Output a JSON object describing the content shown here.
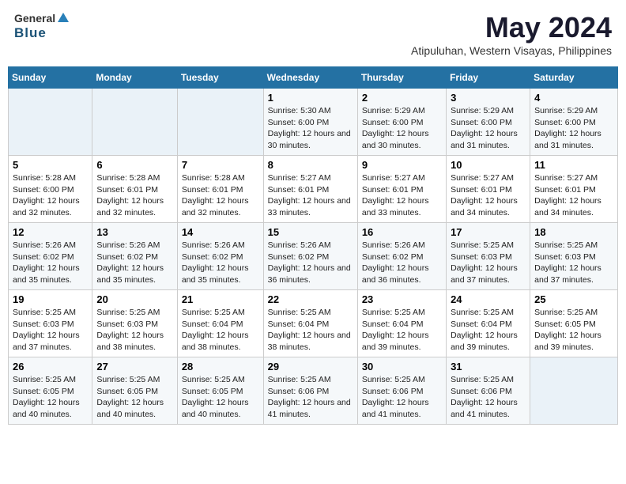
{
  "logo": {
    "general": "General",
    "blue": "Blue"
  },
  "title": "May 2024",
  "subtitle": "Atipuluhan, Western Visayas, Philippines",
  "days_of_week": [
    "Sunday",
    "Monday",
    "Tuesday",
    "Wednesday",
    "Thursday",
    "Friday",
    "Saturday"
  ],
  "weeks": [
    [
      {
        "day": "",
        "info": ""
      },
      {
        "day": "",
        "info": ""
      },
      {
        "day": "",
        "info": ""
      },
      {
        "day": "1",
        "info": "Sunrise: 5:30 AM\nSunset: 6:00 PM\nDaylight: 12 hours and 30 minutes."
      },
      {
        "day": "2",
        "info": "Sunrise: 5:29 AM\nSunset: 6:00 PM\nDaylight: 12 hours and 30 minutes."
      },
      {
        "day": "3",
        "info": "Sunrise: 5:29 AM\nSunset: 6:00 PM\nDaylight: 12 hours and 31 minutes."
      },
      {
        "day": "4",
        "info": "Sunrise: 5:29 AM\nSunset: 6:00 PM\nDaylight: 12 hours and 31 minutes."
      }
    ],
    [
      {
        "day": "5",
        "info": "Sunrise: 5:28 AM\nSunset: 6:00 PM\nDaylight: 12 hours and 32 minutes."
      },
      {
        "day": "6",
        "info": "Sunrise: 5:28 AM\nSunset: 6:01 PM\nDaylight: 12 hours and 32 minutes."
      },
      {
        "day": "7",
        "info": "Sunrise: 5:28 AM\nSunset: 6:01 PM\nDaylight: 12 hours and 32 minutes."
      },
      {
        "day": "8",
        "info": "Sunrise: 5:27 AM\nSunset: 6:01 PM\nDaylight: 12 hours and 33 minutes."
      },
      {
        "day": "9",
        "info": "Sunrise: 5:27 AM\nSunset: 6:01 PM\nDaylight: 12 hours and 33 minutes."
      },
      {
        "day": "10",
        "info": "Sunrise: 5:27 AM\nSunset: 6:01 PM\nDaylight: 12 hours and 34 minutes."
      },
      {
        "day": "11",
        "info": "Sunrise: 5:27 AM\nSunset: 6:01 PM\nDaylight: 12 hours and 34 minutes."
      }
    ],
    [
      {
        "day": "12",
        "info": "Sunrise: 5:26 AM\nSunset: 6:02 PM\nDaylight: 12 hours and 35 minutes."
      },
      {
        "day": "13",
        "info": "Sunrise: 5:26 AM\nSunset: 6:02 PM\nDaylight: 12 hours and 35 minutes."
      },
      {
        "day": "14",
        "info": "Sunrise: 5:26 AM\nSunset: 6:02 PM\nDaylight: 12 hours and 35 minutes."
      },
      {
        "day": "15",
        "info": "Sunrise: 5:26 AM\nSunset: 6:02 PM\nDaylight: 12 hours and 36 minutes."
      },
      {
        "day": "16",
        "info": "Sunrise: 5:26 AM\nSunset: 6:02 PM\nDaylight: 12 hours and 36 minutes."
      },
      {
        "day": "17",
        "info": "Sunrise: 5:25 AM\nSunset: 6:03 PM\nDaylight: 12 hours and 37 minutes."
      },
      {
        "day": "18",
        "info": "Sunrise: 5:25 AM\nSunset: 6:03 PM\nDaylight: 12 hours and 37 minutes."
      }
    ],
    [
      {
        "day": "19",
        "info": "Sunrise: 5:25 AM\nSunset: 6:03 PM\nDaylight: 12 hours and 37 minutes."
      },
      {
        "day": "20",
        "info": "Sunrise: 5:25 AM\nSunset: 6:03 PM\nDaylight: 12 hours and 38 minutes."
      },
      {
        "day": "21",
        "info": "Sunrise: 5:25 AM\nSunset: 6:04 PM\nDaylight: 12 hours and 38 minutes."
      },
      {
        "day": "22",
        "info": "Sunrise: 5:25 AM\nSunset: 6:04 PM\nDaylight: 12 hours and 38 minutes."
      },
      {
        "day": "23",
        "info": "Sunrise: 5:25 AM\nSunset: 6:04 PM\nDaylight: 12 hours and 39 minutes."
      },
      {
        "day": "24",
        "info": "Sunrise: 5:25 AM\nSunset: 6:04 PM\nDaylight: 12 hours and 39 minutes."
      },
      {
        "day": "25",
        "info": "Sunrise: 5:25 AM\nSunset: 6:05 PM\nDaylight: 12 hours and 39 minutes."
      }
    ],
    [
      {
        "day": "26",
        "info": "Sunrise: 5:25 AM\nSunset: 6:05 PM\nDaylight: 12 hours and 40 minutes."
      },
      {
        "day": "27",
        "info": "Sunrise: 5:25 AM\nSunset: 6:05 PM\nDaylight: 12 hours and 40 minutes."
      },
      {
        "day": "28",
        "info": "Sunrise: 5:25 AM\nSunset: 6:05 PM\nDaylight: 12 hours and 40 minutes."
      },
      {
        "day": "29",
        "info": "Sunrise: 5:25 AM\nSunset: 6:06 PM\nDaylight: 12 hours and 41 minutes."
      },
      {
        "day": "30",
        "info": "Sunrise: 5:25 AM\nSunset: 6:06 PM\nDaylight: 12 hours and 41 minutes."
      },
      {
        "day": "31",
        "info": "Sunrise: 5:25 AM\nSunset: 6:06 PM\nDaylight: 12 hours and 41 minutes."
      },
      {
        "day": "",
        "info": ""
      }
    ]
  ]
}
